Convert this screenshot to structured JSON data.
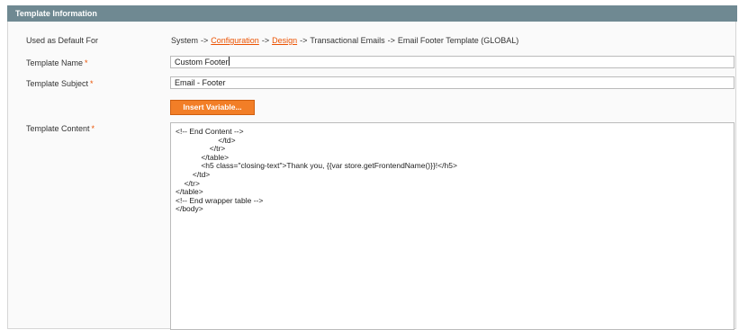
{
  "panel": {
    "title": "Template Information"
  },
  "fields": {
    "used_default": {
      "label": "Used as Default For",
      "path": [
        {
          "text": "System",
          "link": false
        },
        {
          "text": "Configuration",
          "link": true
        },
        {
          "text": "Design",
          "link": true
        },
        {
          "text": "Transactional Emails",
          "link": false
        },
        {
          "text": "Email Footer Template  (GLOBAL)",
          "link": false
        }
      ],
      "separator": "->"
    },
    "template_name": {
      "label": "Template Name",
      "required_mark": "*",
      "value": "Custom Footer"
    },
    "template_subject": {
      "label": "Template Subject",
      "required_mark": "*",
      "value": "Email - Footer"
    },
    "insert_variable": {
      "label": "Insert Variable..."
    },
    "template_content": {
      "label": "Template Content",
      "required_mark": "*",
      "lines": [
        "<!-- End Content -->",
        "                    </td>",
        "                </tr>",
        "            </table>",
        "            <h5 class=\"closing-text\">Thank you, {{var store.getFrontendName()}}!</h5>",
        "        </td>",
        "    </tr>",
        "</table>",
        "<!-- End wrapper table -->",
        "</body>"
      ]
    }
  },
  "colors": {
    "header_bg": "#6f8992",
    "accent": "#eb5202",
    "button_bg": "#f27e27"
  }
}
